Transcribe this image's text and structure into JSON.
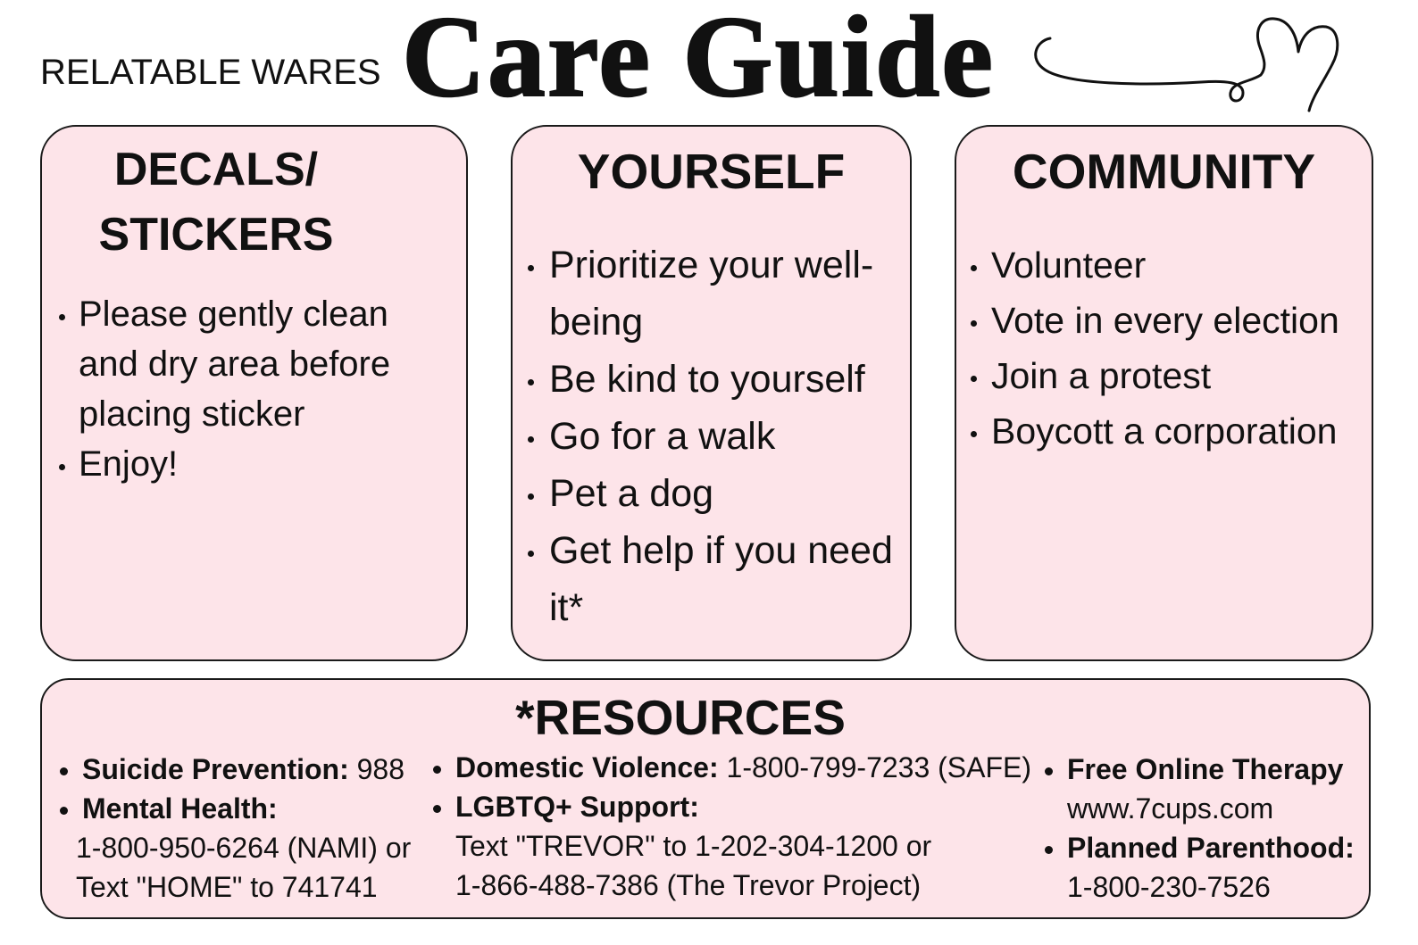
{
  "brand": "RELATABLE WARES",
  "title": "Care Guide",
  "decoration": {
    "icon": "heart-swirl-icon"
  },
  "colors": {
    "page_background": "#ffffff",
    "card_fill": "#fde4e9",
    "card_border": "#1a1a1a",
    "text": "#111111"
  },
  "sections": [
    {
      "heading": "DECALS/ STICKERS",
      "items": [
        "Please gently clean and dry area before placing sticker",
        "Enjoy!"
      ]
    },
    {
      "heading": "YOURSELF",
      "items": [
        "Prioritize your well-being",
        "Be kind to yourself",
        "Go for a walk",
        "Pet a dog",
        "Get help if you need it*"
      ]
    },
    {
      "heading": "COMMUNITY",
      "items": [
        "Volunteer",
        "Vote in every election",
        "Join a protest",
        "Boycott a corporation"
      ]
    }
  ],
  "resources": {
    "heading": "*RESOURCES",
    "columns": [
      {
        "items": [
          {
            "label": "Suicide Prevention:",
            "value": "988",
            "lines": []
          },
          {
            "label": "Mental Health:",
            "value": "",
            "lines": [
              "1-800-950-6264 (NAMI) or",
              "Text \"HOME\" to 741741"
            ]
          }
        ]
      },
      {
        "items": [
          {
            "label": "Domestic Violence:",
            "value": "1-800-799-7233 (SAFE)",
            "lines": []
          },
          {
            "label": "LGBTQ+ Support:",
            "value": "",
            "lines": [
              "Text \"TREVOR\" to 1-202-304-1200 or",
              "1-866-488-7386 (The Trevor Project)"
            ]
          }
        ]
      },
      {
        "items": [
          {
            "label": "Free Online Therapy",
            "value": "",
            "lines": [
              "www.7cups.com"
            ]
          },
          {
            "label": "Planned Parenthood:",
            "value": "",
            "lines": [
              "1-800-230-7526"
            ]
          }
        ]
      }
    ]
  }
}
